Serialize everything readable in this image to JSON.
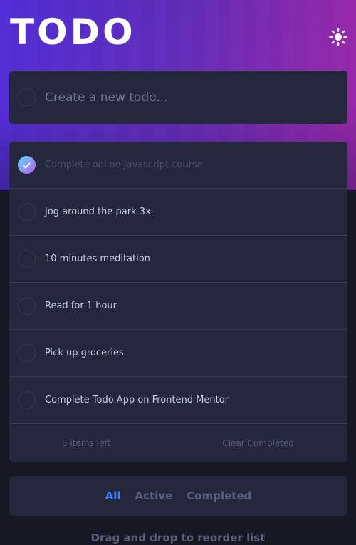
{
  "header": {
    "title": "TODO",
    "theme_icon": "sun-icon"
  },
  "new_todo": {
    "placeholder": "Create a new todo..."
  },
  "todos": [
    {
      "text": "Complete online Javascript course",
      "completed": true
    },
    {
      "text": "Jog around the park 3x",
      "completed": false
    },
    {
      "text": "10 minutes meditation",
      "completed": false
    },
    {
      "text": "Read for 1 hour",
      "completed": false
    },
    {
      "text": "Pick up groceries",
      "completed": false
    },
    {
      "text": "Complete Todo App on Frontend Mentor",
      "completed": false
    }
  ],
  "footer": {
    "items_left": "5 items left",
    "clear_label": "Clear Completed"
  },
  "filters": {
    "all": "All",
    "active": "Active",
    "completed": "Completed",
    "selected": "all"
  },
  "hint": "Drag and drop to reorder list",
  "colors": {
    "accent": "#3a7cfd",
    "check_gradient_start": "#55ddff",
    "check_gradient_end": "#c058f3",
    "card": "#25273d",
    "background": "#171823"
  }
}
